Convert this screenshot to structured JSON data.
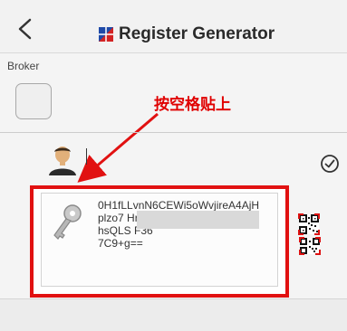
{
  "header": {
    "title": "Register Generator",
    "back_icon": "chevron-left-icon",
    "logo_icon": "flag-logo-icon"
  },
  "broker": {
    "label": "Broker"
  },
  "annotation": {
    "text": "按空格贴上",
    "color": "#e00000"
  },
  "user": {
    "icon": "user-avatar-icon",
    "value": ""
  },
  "status": {
    "icon": "check-circle-icon"
  },
  "key": {
    "icon": "key-icon",
    "lines": [
      "0H1fLLvnN6CEWi5oWvjireA4AjH",
      "plzo7                                          Hrt",
      "hsQLS                                          F36",
      "7C9+g=="
    ]
  },
  "qr": {
    "icon": "qr-code-icon"
  },
  "colors": {
    "accent_red": "#e11111",
    "header_bg": "#f2f2f2",
    "page_bg": "#f4f4f4"
  }
}
